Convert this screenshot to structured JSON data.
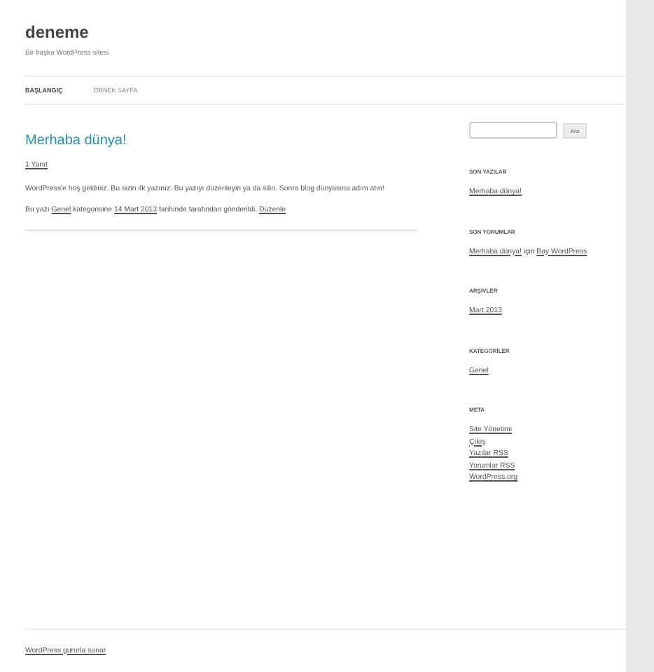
{
  "site": {
    "title": "deneme",
    "tagline": "Bir başka WordPress sitesi"
  },
  "nav": [
    {
      "label": "BAŞLANGIÇ",
      "selected": true
    },
    {
      "label": "ÖRNEK SAYFA",
      "selected": false
    }
  ],
  "post": {
    "title": "Merhaba dünya!",
    "comments": "1 Yanıt",
    "body": "WordPress'e hoş geldiniz. Bu sizin ilk yazınız. Bu yazıyı düzenleyin ya da silin. Sonra blog dünyasına adım atın!",
    "meta": [
      {
        "kind": "text",
        "text": "Bu yazı "
      },
      {
        "kind": "link",
        "text": "Genel"
      },
      {
        "kind": "text",
        "text": " kategorisine "
      },
      {
        "kind": "link",
        "text": "14 Mart 2013"
      },
      {
        "kind": "text",
        "text": " tarihinde tarafından gönderildi. "
      },
      {
        "kind": "link",
        "text": "Düzenle"
      }
    ]
  },
  "search": {
    "button": "Ara"
  },
  "widgets": [
    {
      "title": "SON YAZILAR",
      "items": [
        [
          {
            "kind": "link",
            "text": "Merhaba dünya!"
          }
        ]
      ]
    },
    {
      "title": "SON YORUMLAR",
      "items": [
        [
          {
            "kind": "link",
            "text": "Merhaba dünya!"
          },
          {
            "kind": "text",
            "text": " için "
          },
          {
            "kind": "link",
            "text": "Bay WordPress"
          }
        ]
      ]
    },
    {
      "title": "ARŞİVLER",
      "items": [
        [
          {
            "kind": "link",
            "text": "Mart 2013"
          }
        ]
      ]
    },
    {
      "title": "KATEGORİLER",
      "items": [
        [
          {
            "kind": "link",
            "text": "Genel"
          }
        ]
      ]
    },
    {
      "title": "META",
      "items": [
        [
          {
            "kind": "link",
            "text": "Site Yönetimi"
          }
        ],
        [
          {
            "kind": "link",
            "text": "Çıkış"
          }
        ],
        [
          {
            "kind": "link",
            "text": "Yazılar RSS"
          }
        ],
        [
          {
            "kind": "link",
            "text": "Yorumlar RSS"
          }
        ],
        [
          {
            "kind": "link",
            "text": "WordPress.org"
          }
        ]
      ]
    }
  ],
  "footer": "WordPress gururla sunar"
}
